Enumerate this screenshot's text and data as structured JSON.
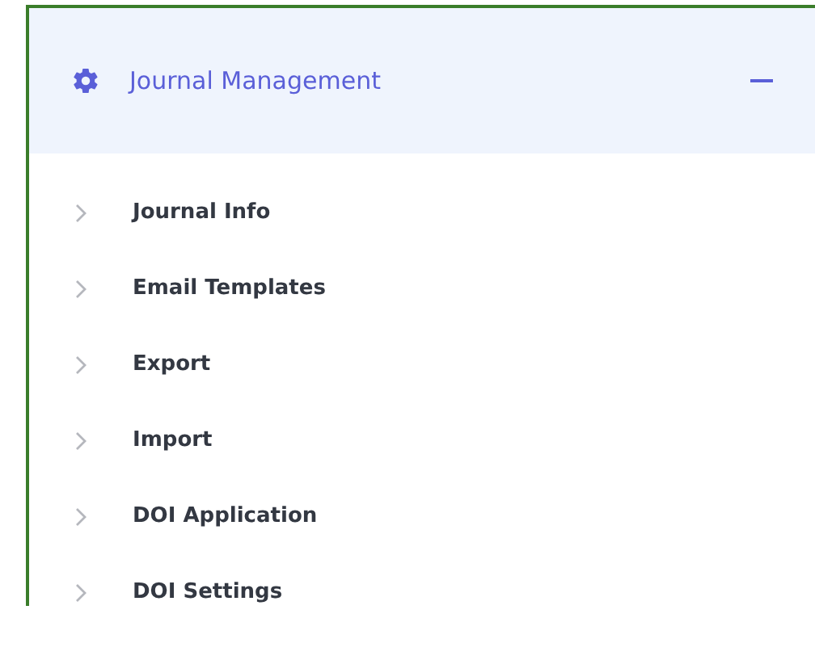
{
  "section": {
    "title": "Journal Management",
    "expanded": true,
    "items": [
      {
        "label": "Journal Info"
      },
      {
        "label": "Email Templates"
      },
      {
        "label": "Export"
      },
      {
        "label": "Import"
      },
      {
        "label": "DOI Application"
      },
      {
        "label": "DOI Settings"
      }
    ]
  }
}
